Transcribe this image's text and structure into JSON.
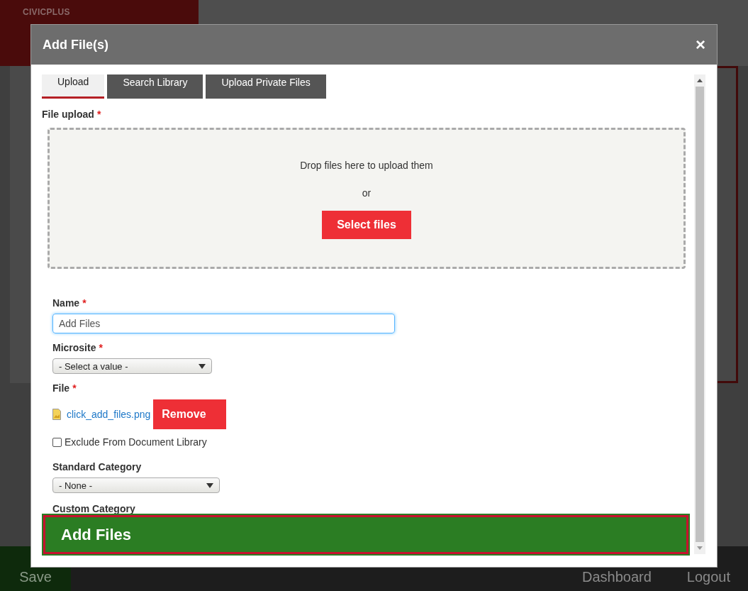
{
  "background": {
    "brand": "CIVICPLUS",
    "save_button": "Save",
    "nav_links": [
      "Dashboard",
      "Logout"
    ]
  },
  "dialog": {
    "title": "Add File(s)",
    "close": "×",
    "tabs": [
      {
        "label": "Upload",
        "selected": true
      },
      {
        "label": "Search Library",
        "selected": false
      },
      {
        "label": "Upload Private Files",
        "selected": false
      }
    ],
    "upload": {
      "label": "File upload",
      "required": "*",
      "drop_text": "Drop files here to upload them",
      "or_text": "or",
      "button": "Select files"
    },
    "name": {
      "label": "Name",
      "required": "*",
      "value": "Add Files",
      "focused": true
    },
    "microsite": {
      "label": "Microsite",
      "required": "*",
      "value": "- Select a value -"
    },
    "file": {
      "label": "File",
      "required": "*",
      "link": "click_add_files.png",
      "remove": "Remove"
    },
    "exclude": {
      "label": "Exclude From Document Library",
      "checked": false
    },
    "standard_category": {
      "label": "Standard Category",
      "value": "- None -"
    },
    "custom_category": {
      "label": "Custom Category"
    },
    "submit": "Add Files"
  }
}
